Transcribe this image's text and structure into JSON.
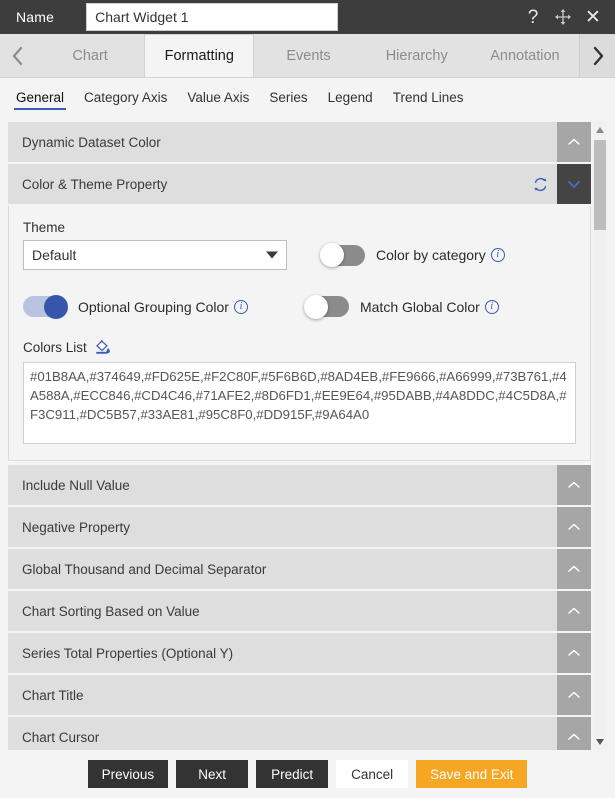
{
  "titlebar": {
    "name_label": "Name",
    "widget_name_value": "Chart Widget 1",
    "widget_name_placeholder": "Chart Widget 1",
    "help_icon": "question-mark-icon",
    "move_icon": "move-arrows-icon",
    "close_icon": "close-icon"
  },
  "tabs": {
    "prev_arrow": "‹",
    "next_arrow": "›",
    "items": [
      {
        "label": "Chart",
        "active": false
      },
      {
        "label": "Formatting",
        "active": true
      },
      {
        "label": "Events",
        "active": false
      },
      {
        "label": "Hierarchy",
        "active": false
      },
      {
        "label": "Annotation",
        "active": false
      }
    ]
  },
  "subtabs": {
    "items": [
      {
        "label": "General",
        "active": true
      },
      {
        "label": "Category Axis",
        "active": false
      },
      {
        "label": "Value Axis",
        "active": false
      },
      {
        "label": "Series",
        "active": false
      },
      {
        "label": "Legend",
        "active": false
      },
      {
        "label": "Trend Lines",
        "active": false
      }
    ]
  },
  "sections": {
    "dynamic_dataset_color": {
      "title": "Dynamic Dataset Color",
      "expanded": false
    },
    "color_theme_property": {
      "title": "Color & Theme Property",
      "expanded": true,
      "refresh_icon": "refresh-icon"
    },
    "collapsed": [
      {
        "title": "Include Null Value"
      },
      {
        "title": "Negative Property"
      },
      {
        "title": "Global Thousand and Decimal Separator"
      },
      {
        "title": "Chart Sorting Based on Value"
      },
      {
        "title": "Series Total Properties (Optional Y)"
      },
      {
        "title": "Chart Title"
      },
      {
        "title": "Chart Cursor"
      }
    ]
  },
  "color_panel": {
    "theme_label": "Theme",
    "theme_value": "Default",
    "color_by_category": {
      "label": "Color by category",
      "state": "off",
      "info_icon": "info-icon"
    },
    "optional_grouping_color": {
      "label": "Optional Grouping Color",
      "state": "on",
      "info_icon": "info-icon"
    },
    "match_global_color": {
      "label": "Match Global Color",
      "state": "off",
      "info_icon": "info-icon"
    },
    "colors_list_label": "Colors List",
    "colors_list_icon": "fill-color-icon",
    "colors_list_value": "#01B8AA,#374649,#FD625E,#F2C80F,#5F6B6D,#8AD4EB,#FE9666,#A66999,#73B761,#4A588A,#ECC846,#CD4C46,#71AFE2,#8D6FD1,#EE9E64,#95DABB,#4A8DDC,#4C5D8A,#F3C911,#DC5B57,#33AE81,#95C8F0,#DD915F,#9A64A0"
  },
  "footer": {
    "buttons": [
      {
        "label": "Previous",
        "style": "dark"
      },
      {
        "label": "Next",
        "style": "dark"
      },
      {
        "label": "Predict",
        "style": "dark"
      },
      {
        "label": "Cancel",
        "style": "light"
      },
      {
        "label": "Save and Exit",
        "style": "accent"
      }
    ]
  },
  "colors": {
    "accent_orange": "#f5a623",
    "toggle_on": "#3655ab",
    "link_blue": "#3a5bb8",
    "titlebar_bg": "#3d3d3d"
  }
}
